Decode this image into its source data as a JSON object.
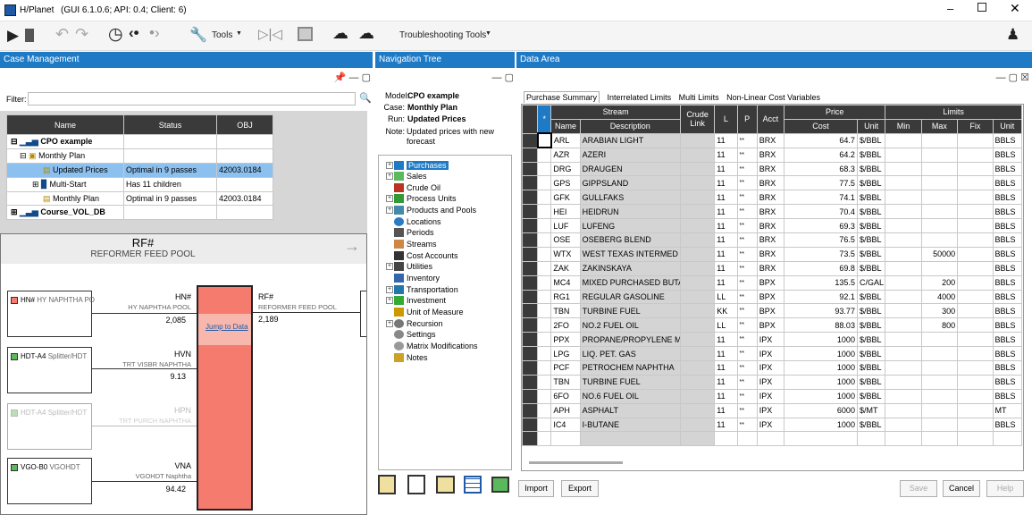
{
  "app": {
    "title": "H/Planet",
    "version": "(GUI 6.1.0.6;  API: 0.4;  Client: 6)"
  },
  "toolbar": {
    "tools_label": "Tools",
    "troubleshooting_label": "Troubleshooting Tools"
  },
  "panels": {
    "case_mgmt": "Case Management",
    "nav_tree": "Navigation Tree",
    "data_area": "Data Area"
  },
  "case_mgmt": {
    "filter_label": "Filter:",
    "filter_value": "",
    "columns": [
      "Name",
      "Status",
      "OBJ"
    ],
    "rows": [
      {
        "name": "CPO example",
        "status": "",
        "obj": ""
      },
      {
        "name": "Monthly Plan",
        "status": "",
        "obj": ""
      },
      {
        "name": "Updated Prices",
        "status": "Optimal in 9 passes",
        "obj": "42003.0184"
      },
      {
        "name": "Multi-Start",
        "status": "Has 11 children",
        "obj": ""
      },
      {
        "name": "Monthly Plan",
        "status": "Optimal in 9 passes",
        "obj": "42003.0184"
      },
      {
        "name": "Course_VOL_DB",
        "status": "",
        "obj": ""
      }
    ]
  },
  "flow": {
    "title": "RF#",
    "subtitle": "REFORMER FEED POOL",
    "jump": "Jump to Data",
    "sources": [
      {
        "code": "HN#",
        "desc": "HY NAPHTHA PO",
        "stream": "HN#",
        "stream_desc": "HY NAPHTHA POOL",
        "value": "2,085"
      },
      {
        "code": "HDT-A4",
        "desc": "Splitter/HDT",
        "stream": "HVN",
        "stream_desc": "TRT VISBR NAPHTHA",
        "value": "9.13"
      },
      {
        "code": "HDT-A4",
        "desc": "Splitter/HDT",
        "stream": "HPN",
        "stream_desc": "TRT PURCH NAPHTHA",
        "value": ""
      },
      {
        "code": "VGO-B0",
        "desc": "VGOHDT",
        "stream": "VNA",
        "stream_desc": "VGOHDT Naphtha",
        "value": "94.42"
      }
    ],
    "output": {
      "stream": "RF#",
      "desc": "REFORMER FEED POOL",
      "value": "2,189"
    }
  },
  "nav": {
    "model_label": "Model:",
    "model": "CPO example",
    "case_label": "Case:",
    "case": "Monthly Plan",
    "run_label": "Run:",
    "run": "Updated Prices",
    "note_label": "Note:",
    "note": "Updated prices with new forecast",
    "items": [
      "Purchases",
      "Sales",
      "Crude Oil",
      "Process Units",
      "Products and Pools",
      "Locations",
      "Periods",
      "Streams",
      "Cost Accounts",
      "Utilities",
      "Inventory",
      "Transportation",
      "Investment",
      "Unit of Measure",
      "Recursion",
      "Settings",
      "Matrix Modifications",
      "Notes"
    ]
  },
  "data": {
    "tabs": [
      "Purchase Summary",
      "Interrelated Limits",
      "Multi Limits",
      "Non-Linear Cost Variables"
    ],
    "head": {
      "star": "*",
      "stream": "Stream",
      "name": "Name",
      "desc": "Description",
      "crude": "Crude Link",
      "l": "L",
      "p": "P",
      "acct": "Acct",
      "price": "Price",
      "cost": "Cost",
      "unit": "Unit",
      "limits": "Limits",
      "min": "Min",
      "max": "Max",
      "fix": "Fix",
      "lunit": "Unit"
    },
    "rows": [
      [
        "ARL",
        "ARABIAN LIGHT",
        "11",
        "**",
        "BRX",
        "64.7",
        "$/BBL",
        "",
        "",
        "",
        "BBLS"
      ],
      [
        "AZR",
        "AZERI",
        "11",
        "**",
        "BRX",
        "64.2",
        "$/BBL",
        "",
        "",
        "",
        "BBLS"
      ],
      [
        "DRG",
        "DRAUGEN",
        "11",
        "**",
        "BRX",
        "68.3",
        "$/BBL",
        "",
        "",
        "",
        "BBLS"
      ],
      [
        "GPS",
        "GIPPSLAND",
        "11",
        "**",
        "BRX",
        "77.5",
        "$/BBL",
        "",
        "",
        "",
        "BBLS"
      ],
      [
        "GFK",
        "GULLFAKS",
        "11",
        "**",
        "BRX",
        "74.1",
        "$/BBL",
        "",
        "",
        "",
        "BBLS"
      ],
      [
        "HEI",
        "HEIDRUN",
        "11",
        "**",
        "BRX",
        "70.4",
        "$/BBL",
        "",
        "",
        "",
        "BBLS"
      ],
      [
        "LUF",
        "LUFENG",
        "11",
        "**",
        "BRX",
        "69.3",
        "$/BBL",
        "",
        "",
        "",
        "BBLS"
      ],
      [
        "OSE",
        "OSEBERG BLEND",
        "11",
        "**",
        "BRX",
        "76.5",
        "$/BBL",
        "",
        "",
        "",
        "BBLS"
      ],
      [
        "WTX",
        "WEST TEXAS INTERMED",
        "11",
        "**",
        "BRX",
        "73.5",
        "$/BBL",
        "",
        "50000",
        "",
        "BBLS"
      ],
      [
        "ZAK",
        "ZAKINSKAYA",
        "11",
        "**",
        "BRX",
        "69.8",
        "$/BBL",
        "",
        "",
        "",
        "BBLS"
      ],
      [
        "MC4",
        "MIXED PURCHASED BUTA",
        "11",
        "**",
        "BPX",
        "135.5",
        "C/GAL",
        "",
        "200",
        "",
        "BBLS"
      ],
      [
        "RG1",
        "REGULAR GASOLINE",
        "LL",
        "**",
        "BPX",
        "92.1",
        "$/BBL",
        "",
        "4000",
        "",
        "BBLS"
      ],
      [
        "TBN",
        "TURBINE FUEL",
        "KK",
        "**",
        "BPX",
        "93.77",
        "$/BBL",
        "",
        "300",
        "",
        "BBLS"
      ],
      [
        "2FO",
        "NO.2 FUEL OIL",
        "LL",
        "**",
        "BPX",
        "88.03",
        "$/BBL",
        "",
        "800",
        "",
        "BBLS"
      ],
      [
        "PPX",
        "PROPANE/PROPYLENE MI",
        "11",
        "**",
        "IPX",
        "1000",
        "$/BBL",
        "",
        "",
        "",
        "BBLS"
      ],
      [
        "LPG",
        "LIQ. PET. GAS",
        "11",
        "**",
        "IPX",
        "1000",
        "$/BBL",
        "",
        "",
        "",
        "BBLS"
      ],
      [
        "PCF",
        "PETROCHEM NAPHTHA",
        "11",
        "**",
        "IPX",
        "1000",
        "$/BBL",
        "",
        "",
        "",
        "BBLS"
      ],
      [
        "TBN",
        "TURBINE FUEL",
        "11",
        "**",
        "IPX",
        "1000",
        "$/BBL",
        "",
        "",
        "",
        "BBLS"
      ],
      [
        "6FO",
        "NO.6 FUEL OIL",
        "11",
        "**",
        "IPX",
        "1000",
        "$/BBL",
        "",
        "",
        "",
        "BBLS"
      ],
      [
        "APH",
        "ASPHALT",
        "11",
        "**",
        "IPX",
        "6000",
        "$/MT",
        "",
        "",
        "",
        "MT"
      ],
      [
        "IC4",
        "I-BUTANE",
        "11",
        "**",
        "IPX",
        "1000",
        "$/BBL",
        "",
        "",
        "",
        "BBLS"
      ]
    ]
  },
  "buttons": {
    "import": "Import",
    "export": "Export",
    "save": "Save",
    "cancel": "Cancel",
    "help": "Help"
  }
}
